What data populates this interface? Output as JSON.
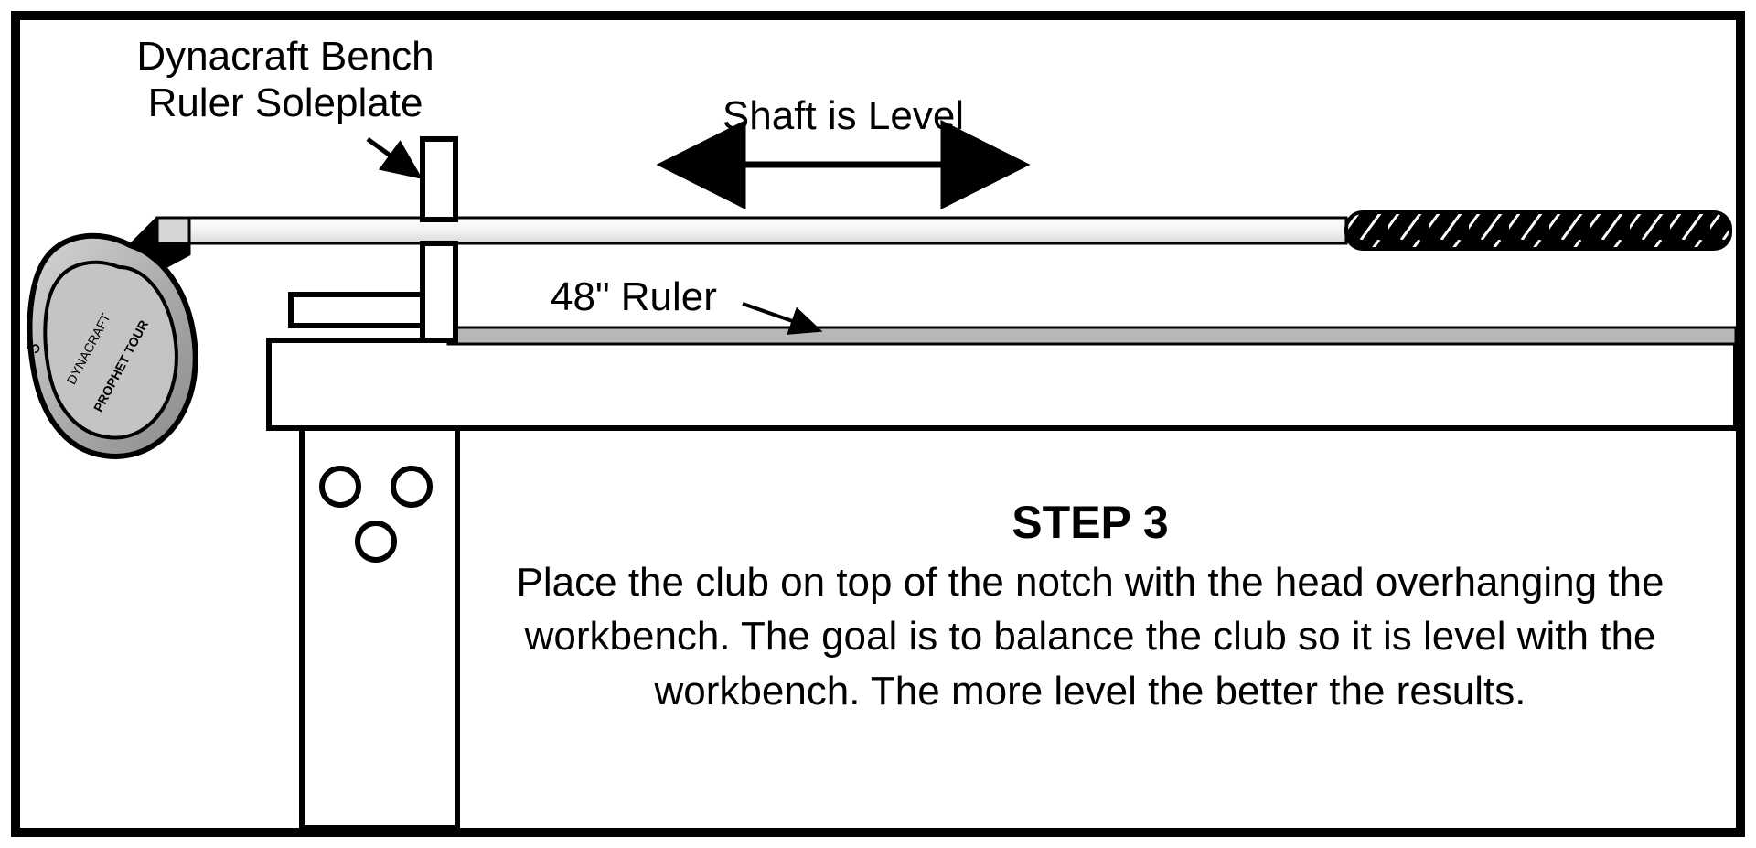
{
  "labels": {
    "soleplate_line1": "Dynacraft Bench",
    "soleplate_line2": "Ruler Soleplate",
    "shaft_level": "Shaft is Level",
    "ruler_label": "48\" Ruler"
  },
  "step": {
    "title": "STEP 3",
    "body": "Place the club on top of the notch with the head overhanging the workbench.  The goal is to balance the club so it is level with the workbench. The more level the better the results."
  },
  "clubhead": {
    "brand": "DYNACRAFT",
    "model": "PROPHET TOUR",
    "number": "5"
  }
}
